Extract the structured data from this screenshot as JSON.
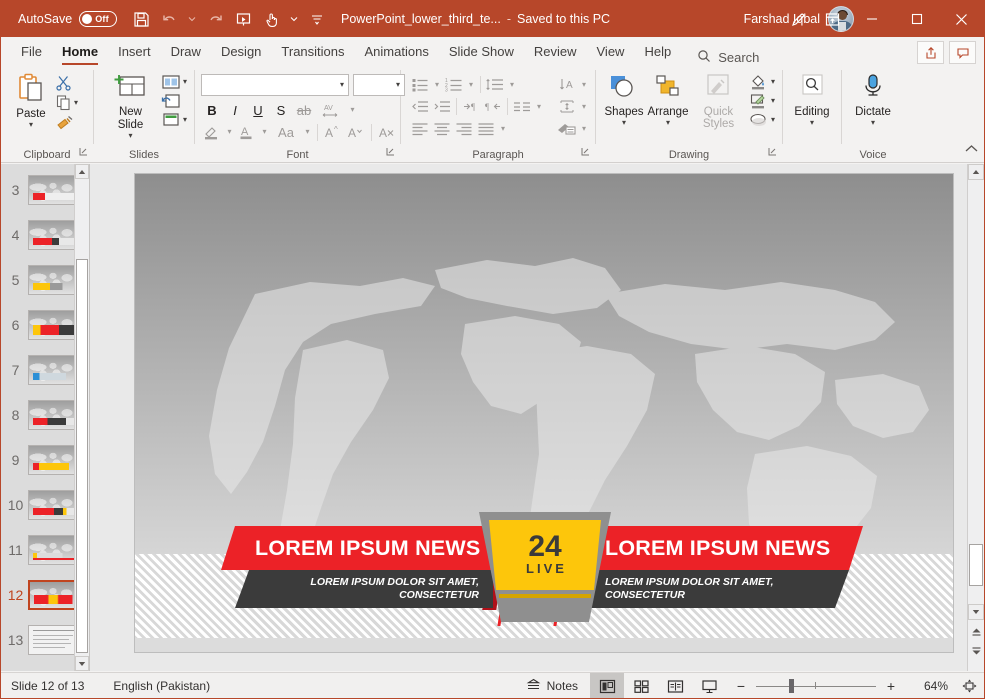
{
  "titlebar": {
    "autosave_label": "AutoSave",
    "autosave_state": "Off",
    "doc_title": "PowerPoint_lower_third_te...",
    "save_separator": "-",
    "saved_state": "Saved to this PC",
    "user_name": "Farshad Iqbal",
    "quick_access": [
      {
        "name": "save-icon",
        "tooltip": "Save"
      },
      {
        "name": "undo-icon",
        "tooltip": "Undo"
      },
      {
        "name": "redo-icon",
        "tooltip": "Redo"
      },
      {
        "name": "start-presentation-icon",
        "tooltip": "Start From Beginning"
      },
      {
        "name": "touch-mode-icon",
        "tooltip": "Touch/Mouse Mode"
      },
      {
        "name": "customize-qat-icon",
        "tooltip": "Customize Quick Access Toolbar"
      }
    ],
    "window_buttons": [
      "minimize",
      "maximize",
      "close"
    ]
  },
  "tabs": [
    {
      "label": "File",
      "active": false
    },
    {
      "label": "Home",
      "active": true
    },
    {
      "label": "Insert",
      "active": false
    },
    {
      "label": "Draw",
      "active": false
    },
    {
      "label": "Design",
      "active": false
    },
    {
      "label": "Transitions",
      "active": false
    },
    {
      "label": "Animations",
      "active": false
    },
    {
      "label": "Slide Show",
      "active": false
    },
    {
      "label": "Review",
      "active": false
    },
    {
      "label": "View",
      "active": false
    },
    {
      "label": "Help",
      "active": false
    }
  ],
  "search": {
    "label": "Search"
  },
  "tab_actions": {
    "share_label": "Share",
    "comments_label": "Comments"
  },
  "ribbon": {
    "groups": [
      {
        "name": "Clipboard",
        "label": "Clipboard",
        "buttons": [
          {
            "label": "Paste",
            "name": "paste-button"
          },
          {
            "label": "Cut",
            "name": "cut-button"
          },
          {
            "label": "Copy",
            "name": "copy-button"
          },
          {
            "label": "Format Painter",
            "name": "format-painter-button"
          }
        ]
      },
      {
        "name": "Slides",
        "label": "Slides",
        "buttons": [
          {
            "label": "New Slide",
            "name": "new-slide-button"
          },
          {
            "label": "Layout",
            "name": "layout-button"
          },
          {
            "label": "Reset",
            "name": "reset-button"
          },
          {
            "label": "Section",
            "name": "section-button"
          }
        ]
      },
      {
        "name": "Font",
        "label": "Font",
        "font_name_value": "",
        "font_size_value": "",
        "buttons": [
          {
            "label": "B",
            "name": "bold-button"
          },
          {
            "label": "I",
            "name": "italic-button"
          },
          {
            "label": "U",
            "name": "underline-button"
          },
          {
            "label": "S",
            "name": "text-shadow-button"
          },
          {
            "label": "ab",
            "name": "strikethrough-button"
          },
          {
            "label": "AV",
            "name": "character-spacing-button"
          },
          {
            "label": "Aa",
            "name": "change-case-button"
          },
          {
            "label": "A",
            "name": "increase-font-size-button"
          },
          {
            "label": "A",
            "name": "decrease-font-size-button"
          }
        ]
      },
      {
        "name": "Paragraph",
        "label": "Paragraph",
        "buttons": [
          {
            "label": "Bullets",
            "name": "bullets-button"
          },
          {
            "label": "Numbering",
            "name": "numbering-button"
          },
          {
            "label": "Line Spacing",
            "name": "line-spacing-button"
          },
          {
            "label": "Text Direction",
            "name": "text-direction-button"
          },
          {
            "label": "Align Text",
            "name": "align-text-button"
          },
          {
            "label": "Convert to SmartArt",
            "name": "smartart-button"
          }
        ]
      },
      {
        "name": "Drawing",
        "label": "Drawing",
        "buttons": [
          {
            "label": "Shapes",
            "name": "shapes-button"
          },
          {
            "label": "Arrange",
            "name": "arrange-button"
          },
          {
            "label": "Quick Styles",
            "name": "quick-styles-button"
          },
          {
            "label": "Shape Fill",
            "name": "shape-fill-button"
          },
          {
            "label": "Shape Outline",
            "name": "shape-outline-button"
          },
          {
            "label": "Shape Effects",
            "name": "shape-effects-button"
          }
        ]
      },
      {
        "name": "Editing",
        "label": "",
        "buttons": [
          {
            "label": "Editing",
            "name": "editing-button"
          }
        ]
      },
      {
        "name": "Voice",
        "label": "Voice",
        "buttons": [
          {
            "label": "Dictate",
            "name": "dictate-button"
          }
        ]
      }
    ]
  },
  "thumbnails": {
    "slides": [
      {
        "number": "3",
        "selected": false
      },
      {
        "number": "4",
        "selected": false
      },
      {
        "number": "5",
        "selected": false
      },
      {
        "number": "6",
        "selected": false
      },
      {
        "number": "7",
        "selected": false
      },
      {
        "number": "8",
        "selected": false
      },
      {
        "number": "9",
        "selected": false
      },
      {
        "number": "10",
        "selected": false
      },
      {
        "number": "11",
        "selected": false
      },
      {
        "number": "12",
        "selected": true
      },
      {
        "number": "13",
        "selected": false
      }
    ]
  },
  "slide": {
    "left_banner": {
      "title": "LOREM IPSUM NEWS",
      "subtitle": "LOREM IPSUM DOLOR SIT AMET, CONSECTETUR"
    },
    "right_banner": {
      "title": "LOREM IPSUM NEWS",
      "subtitle": "LOREM IPSUM DOLOR SIT AMET, CONSECTETUR"
    },
    "badge": {
      "number": "24",
      "live_label": "LIVE"
    },
    "colors": {
      "red": "#ec2227",
      "dark_red": "#c1121f",
      "yellow": "#fdc60b",
      "gold": "#d4a400",
      "dark_grey": "#3b3b3b",
      "grey": "#8f8f8f"
    }
  },
  "statusbar": {
    "slide_counter": "Slide 12 of 13",
    "language": "English (Pakistan)",
    "notes_label": "Notes",
    "views": [
      {
        "name": "normal-view-button",
        "active": true
      },
      {
        "name": "slide-sorter-view-button",
        "active": false
      },
      {
        "name": "reading-view-button",
        "active": false
      },
      {
        "name": "slide-show-button",
        "active": false
      }
    ],
    "zoom_percent": "64%",
    "zoom_minus": "−",
    "zoom_plus": "+"
  }
}
